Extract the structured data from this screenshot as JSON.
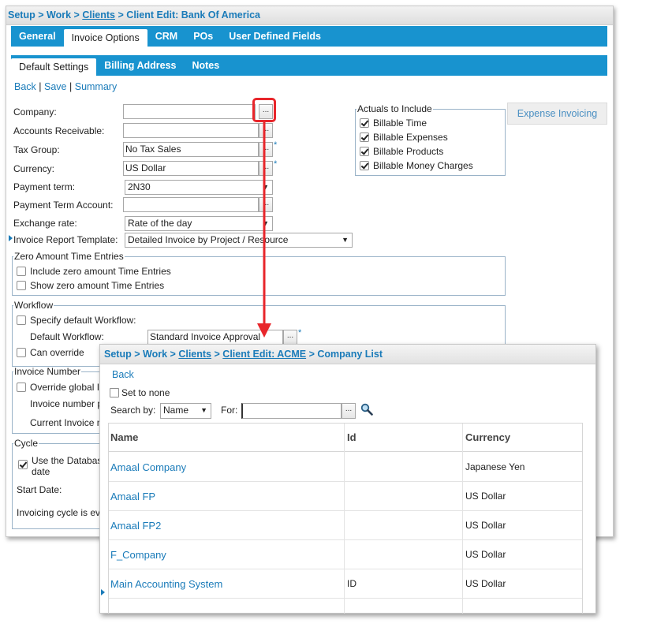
{
  "main": {
    "breadcrumb": {
      "setup": "Setup",
      "work": "Work",
      "clients": "Clients",
      "current": "Client Edit: Bank Of America",
      "sep": ">"
    },
    "tabs": [
      "General",
      "Invoice Options",
      "CRM",
      "POs",
      "User Defined Fields"
    ],
    "subtabs": [
      "Default Settings",
      "Billing Address",
      "Notes"
    ],
    "actions": {
      "back": "Back",
      "save": "Save",
      "summary": "Summary",
      "sep": "|"
    },
    "form": {
      "company_label": "Company:",
      "company_value": "",
      "ar_label": "Accounts Receivable:",
      "ar_value": "",
      "taxgroup_label": "Tax Group:",
      "taxgroup_value": "No Tax Sales",
      "currency_label": "Currency:",
      "currency_value": "US Dollar",
      "payterm_label": "Payment term:",
      "payterm_value": "2N30",
      "payterm_account_label": "Payment Term Account:",
      "payterm_account_value": "",
      "exchange_label": "Exchange rate:",
      "exchange_value": "Rate of the day",
      "template_label": "Invoice Report Template:",
      "template_value": "Detailed Invoice by Project / Resource",
      "lookup_glyph": "...",
      "required_mark": "*"
    },
    "actuals": {
      "legend": "Actuals to Include",
      "items": [
        "Billable Time",
        "Billable Expenses",
        "Billable Products",
        "Billable Money Charges"
      ]
    },
    "expense_button": "Expense Invoicing",
    "zero_amount": {
      "legend": "Zero Amount Time Entries",
      "include": "Include zero amount Time Entries",
      "show": "Show zero amount Time Entries"
    },
    "workflow": {
      "legend": "Workflow",
      "specify": "Specify default Workflow:",
      "default_label": "Default Workflow:",
      "default_value": "Standard Invoice Approval",
      "can_override": "Can override"
    },
    "invoice_number": {
      "legend": "Invoice Number",
      "override": "Override global I",
      "number_prefix": "Invoice number p",
      "current": "Current Invoice n"
    },
    "cycle": {
      "legend": "Cycle",
      "use_db": "Use the Databas",
      "date": "date",
      "start_date": "Start Date:",
      "every": "Invoicing cycle is ev"
    }
  },
  "popup": {
    "breadcrumb": {
      "setup": "Setup",
      "work": "Work",
      "clients": "Clients",
      "client_edit": "Client Edit: ACME",
      "current": "Company List",
      "sep": ">"
    },
    "back": "Back",
    "set_to_none": "Set to none",
    "search_by_label": "Search by:",
    "search_by_value": "Name",
    "for_label": "For:",
    "for_value": "",
    "lookup_glyph": "...",
    "columns": [
      "Name",
      "Id",
      "Currency"
    ],
    "rows": [
      {
        "name": "Amaal Company",
        "id": "",
        "currency": "Japanese Yen"
      },
      {
        "name": "Amaal FP",
        "id": "",
        "currency": "US Dollar"
      },
      {
        "name": "Amaal FP2",
        "id": "",
        "currency": "US Dollar"
      },
      {
        "name": "F_Company",
        "id": "",
        "currency": "US Dollar"
      },
      {
        "name": "Main Accounting System",
        "id": "ID",
        "currency": "US Dollar"
      }
    ]
  },
  "colors": {
    "accent_blue": "#1893cf",
    "link_blue": "#1a7bb9",
    "annotation_red": "#e8262b"
  }
}
